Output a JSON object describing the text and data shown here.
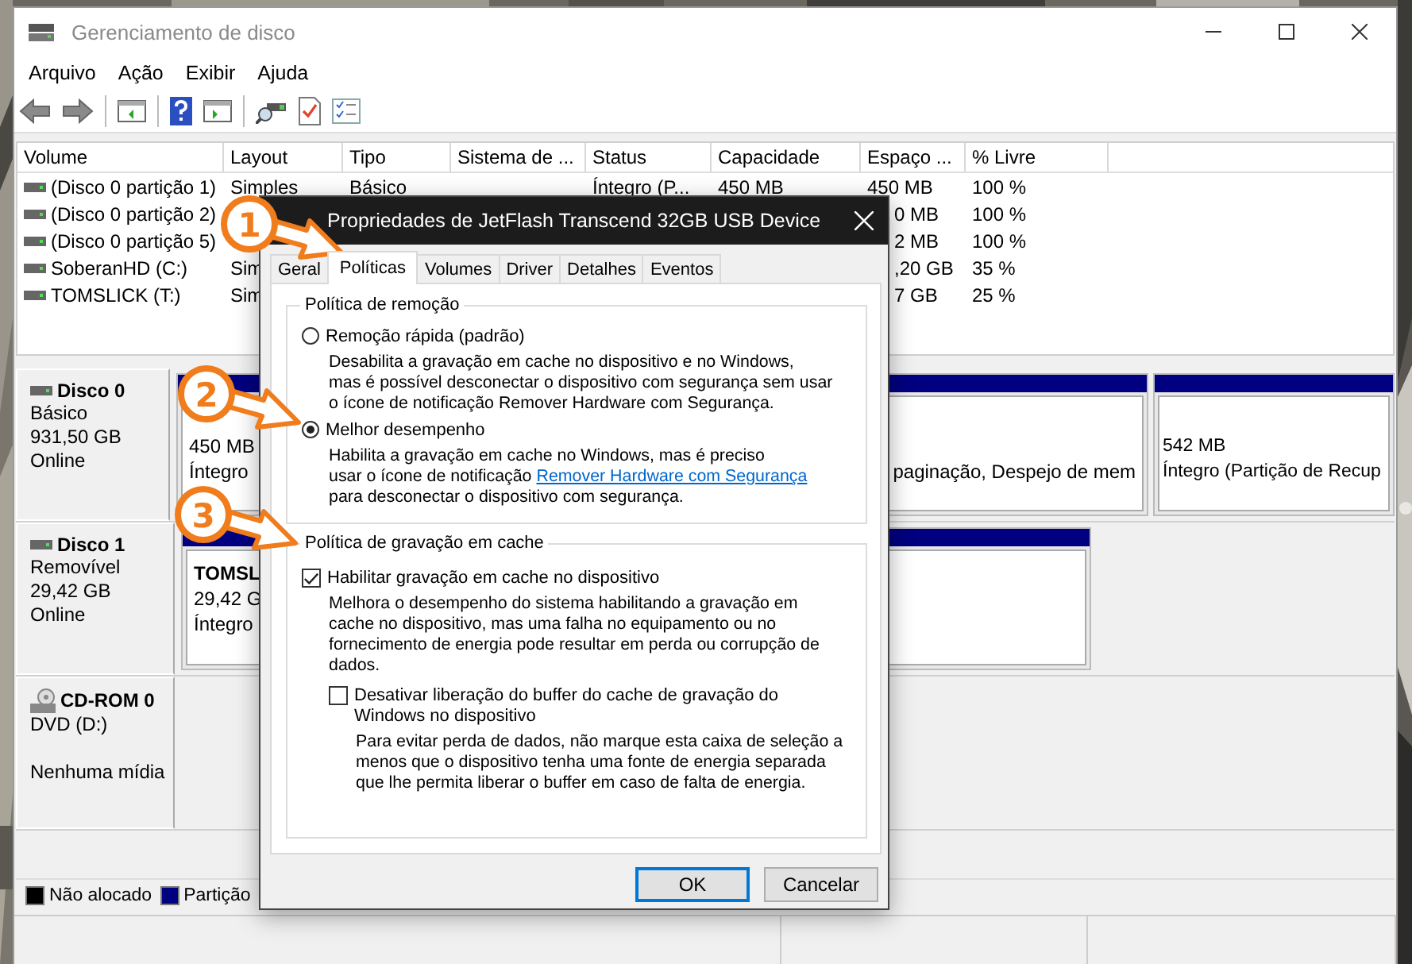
{
  "window": {
    "title": "Gerenciamento de disco"
  },
  "menu": [
    "Arquivo",
    "Ação",
    "Exibir",
    "Ajuda"
  ],
  "volume_table": {
    "columns": [
      "Volume",
      "Layout",
      "Tipo",
      "Sistema de ...",
      "Status",
      "Capacidade",
      "Espaço ...",
      "% Livre"
    ],
    "rows": [
      {
        "volume": "(Disco 0 partição 1)",
        "layout": "Simples",
        "type": "Básico",
        "status": "Íntegro (P...",
        "capacity": "450 MB",
        "free_space": "450 MB",
        "percent_free": "100 %"
      },
      {
        "volume": "(Disco 0 partição 2)",
        "free_space": "0 MB",
        "percent_free": "100 %"
      },
      {
        "volume": "(Disco 0 partição 5)",
        "free_space": "2 MB",
        "percent_free": "100 %"
      },
      {
        "volume": "SoberanHD (C:)",
        "layout": "Sim",
        "free_space": ",20 GB",
        "percent_free": "35 %"
      },
      {
        "volume": "TOMSLICK (T:)",
        "layout": "Sim",
        "free_space": "7 GB",
        "percent_free": "25 %"
      }
    ]
  },
  "disks": [
    {
      "name": "Disco 0",
      "kind": "hdd",
      "lines": [
        "Básico",
        "931,50 GB",
        "Online"
      ],
      "partitions": [
        {
          "lines": [
            "450 MB",
            "Íntegro"
          ]
        },
        {
          "lines": [
            "paginação, Despejo de mem"
          ]
        },
        {
          "lines": [
            "542 MB",
            "Íntegro (Partição de Recup"
          ]
        }
      ]
    },
    {
      "name": "Disco 1",
      "kind": "hdd",
      "lines": [
        "Removível",
        "29,42 GB",
        "Online"
      ],
      "partitions": [
        {
          "title": "TOMSL",
          "lines": [
            "29,42 G",
            "Íntegro"
          ]
        }
      ]
    },
    {
      "name": "CD-ROM 0",
      "kind": "cdrom",
      "lines": [
        "DVD (D:)",
        "Nenhuma mídia"
      ]
    }
  ],
  "legend": [
    {
      "label": "Não alocado",
      "color": "#000000"
    },
    {
      "label": "Partição",
      "color": "#000080"
    }
  ],
  "dialog": {
    "title": "Propriedades de JetFlash Transcend 32GB USB Device",
    "tabs": [
      {
        "label": "Geral",
        "selected": false
      },
      {
        "label": "Políticas",
        "selected": true
      },
      {
        "label": "Volumes",
        "selected": false
      },
      {
        "label": "Driver",
        "selected": false
      },
      {
        "label": "Detalhes",
        "selected": false
      },
      {
        "label": "Eventos",
        "selected": false
      }
    ],
    "groups": [
      {
        "title": "Política de remoção",
        "options": [
          {
            "kind": "radio",
            "label": "Remoção rápida (padrão)",
            "selected": false,
            "description": "Desabilita a gravação em cache no dispositivo e no Windows,\nmas é possível desconectar o dispositivo com segurança sem usar\no ícone de notificação Remover Hardware com Segurança."
          },
          {
            "kind": "radio",
            "label": "Melhor desempenho",
            "selected": true,
            "description": "Habilita a gravação em cache no Windows, mas é preciso\nusar o ícone de notificação",
            "link": "Remover Hardware com Segurança",
            "description_after": "para desconectar o dispositivo com segurança."
          }
        ]
      },
      {
        "title": "Política de gravação em cache",
        "options": [
          {
            "kind": "checkbox",
            "label": "Habilitar gravação em cache no dispositivo",
            "checked": true,
            "description": "Melhora o desempenho do sistema habilitando a gravação em\ncache no dispositivo, mas uma falha no equipamento ou no\nfornecimento de energia pode resultar em perda ou corrupção de\ndados.",
            "children": [
              {
                "kind": "checkbox",
                "label": "Desativar liberação do buffer do cache de gravação do\nWindows no dispositivo",
                "checked": false,
                "description": "Para evitar perda de dados, não marque esta caixa de seleção a\nmenos que o dispositivo tenha uma fonte de energia separada\nque lhe permita liberar o buffer em caso de falta de energia."
              }
            ]
          }
        ]
      }
    ],
    "buttons": [
      {
        "label": "OK",
        "default": true
      },
      {
        "label": "Cancelar",
        "default": false
      }
    ]
  },
  "callouts": [
    {
      "number": "1"
    },
    {
      "number": "2"
    },
    {
      "number": "3"
    }
  ]
}
